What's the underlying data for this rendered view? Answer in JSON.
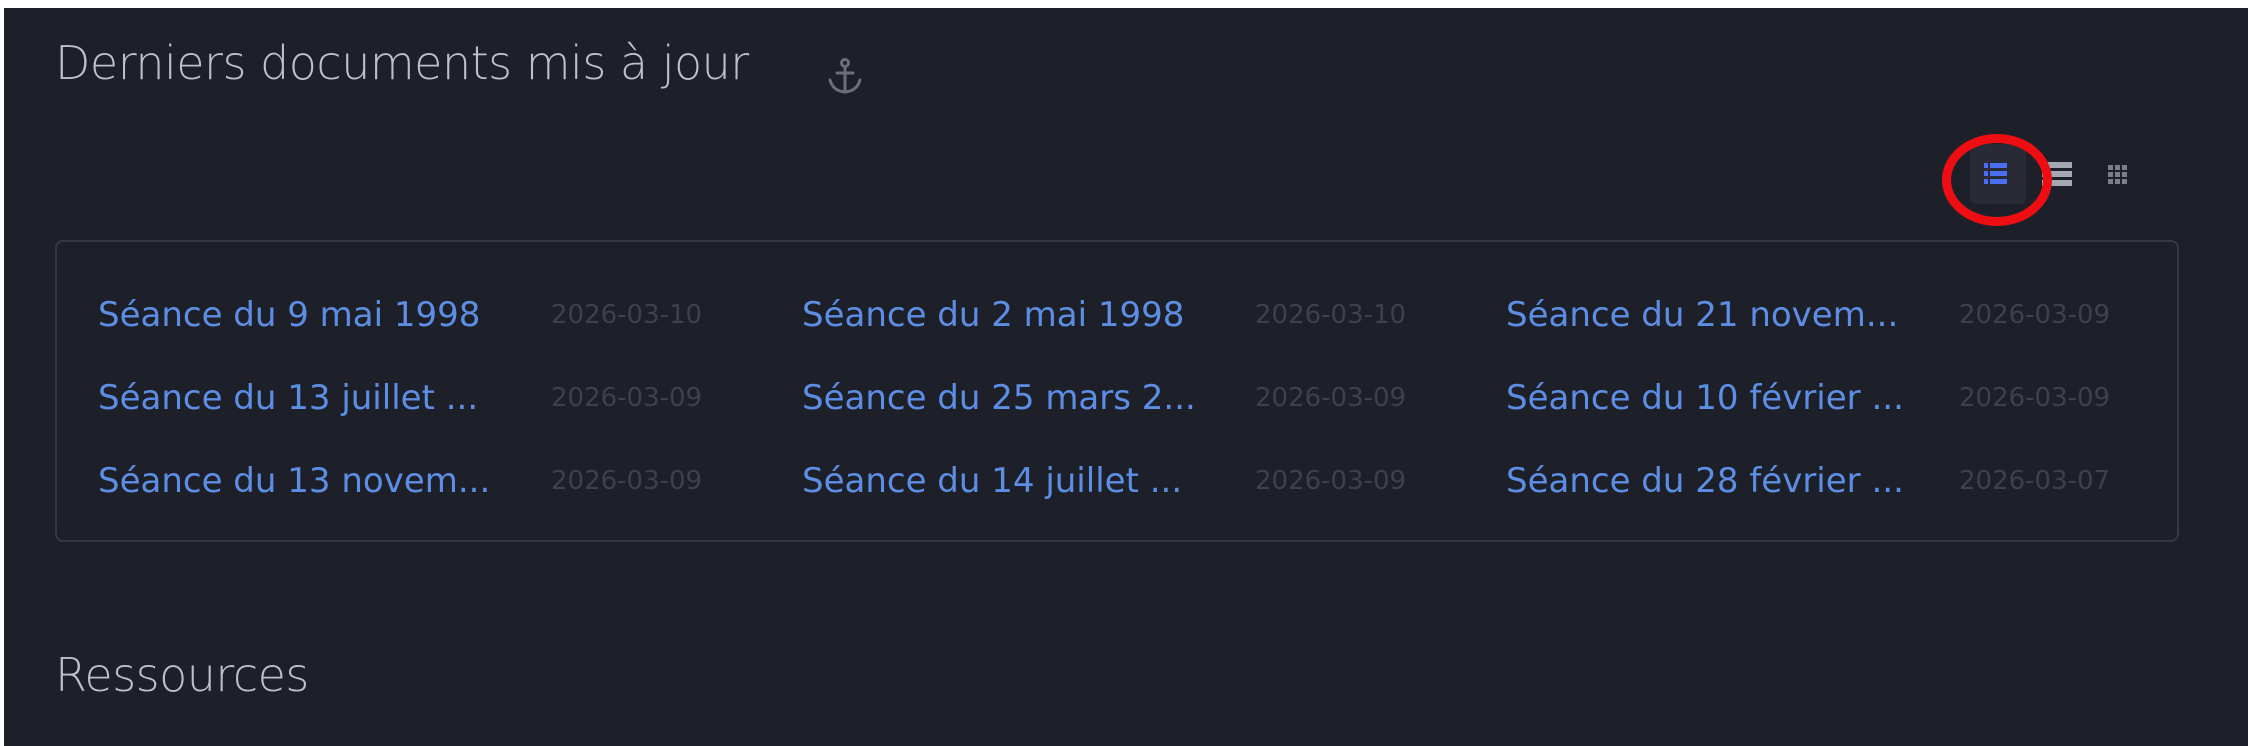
{
  "recent": {
    "title": "Derniers documents mis à jour",
    "items": [
      {
        "label": "Séance du 9 mai 1998",
        "date": "2026-03-10"
      },
      {
        "label": "Séance du 2 mai 1998",
        "date": "2026-03-10"
      },
      {
        "label": "Séance du 21 novem...",
        "date": "2026-03-09"
      },
      {
        "label": "Séance du 13 juillet ...",
        "date": "2026-03-09"
      },
      {
        "label": "Séance du 25 mars 2...",
        "date": "2026-03-09"
      },
      {
        "label": "Séance du 10 février ...",
        "date": "2026-03-09"
      },
      {
        "label": "Séance du 13 novem...",
        "date": "2026-03-09"
      },
      {
        "label": "Séance du 14 juillet ...",
        "date": "2026-03-09"
      },
      {
        "label": "Séance du 28 février ...",
        "date": "2026-03-07"
      }
    ]
  },
  "view_options": {
    "active": "list",
    "icons": [
      "list-view-icon",
      "compact-view-icon",
      "grid-view-icon"
    ]
  },
  "resources": {
    "title": "Ressources"
  },
  "colors": {
    "background": "#1e2029",
    "title": "#bcc0c8",
    "link": "#5d8ee5",
    "date": "#3d414b",
    "accent": "#4c6ef5",
    "highlight": "#ee0d12"
  }
}
